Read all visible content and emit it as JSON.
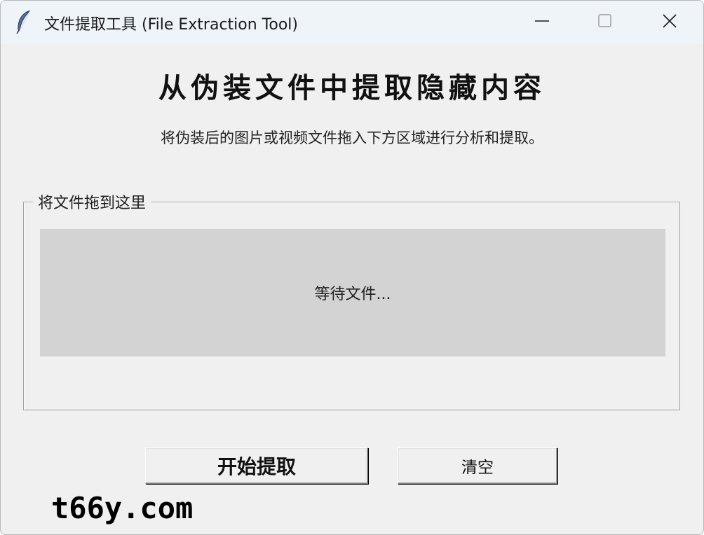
{
  "window": {
    "title": "文件提取工具 (File Extraction Tool)",
    "icon": "feather-icon"
  },
  "controls": {
    "minimize_icon": "minimize-icon",
    "maximize_icon": "maximize-icon",
    "close_icon": "close-icon"
  },
  "main": {
    "heading": "从伪装文件中提取隐藏内容",
    "subtitle": "将伪装后的图片或视频文件拖入下方区域进行分析和提取。",
    "group_label": "将文件拖到这里",
    "drop_status": "等待文件..."
  },
  "buttons": {
    "start_label": "开始提取",
    "clear_label": "清空"
  },
  "watermark": "t66y.com",
  "colors": {
    "titlebar_bg": "#eff4f9",
    "window_bg": "#f0f0f0",
    "dropzone_bg": "#d3d3d3"
  }
}
